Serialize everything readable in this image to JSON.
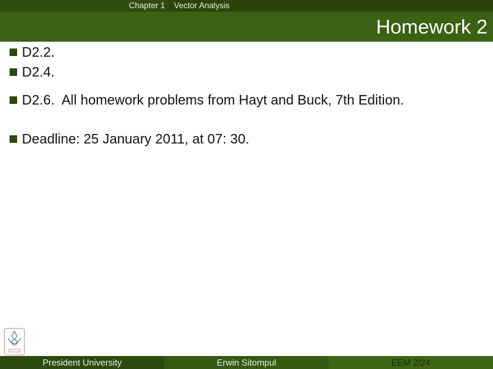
{
  "header": {
    "chapter": "Chapter 1",
    "section": "Vector Analysis",
    "title": "Homework 2"
  },
  "bullets": [
    "D2.2.",
    "D2.4.",
    "D2.6.  All homework problems from Hayt and Buck, 7th Edition.",
    "Deadline: 25 January 2011, at 07: 30."
  ],
  "footer": {
    "left": "President University",
    "center": "Erwin Sitompul",
    "right": "EEM 2/24"
  },
  "colors": {
    "accent": "#3b6114",
    "dark": "#2f4d0f"
  },
  "logo": {
    "icon": "president-university-logo"
  }
}
